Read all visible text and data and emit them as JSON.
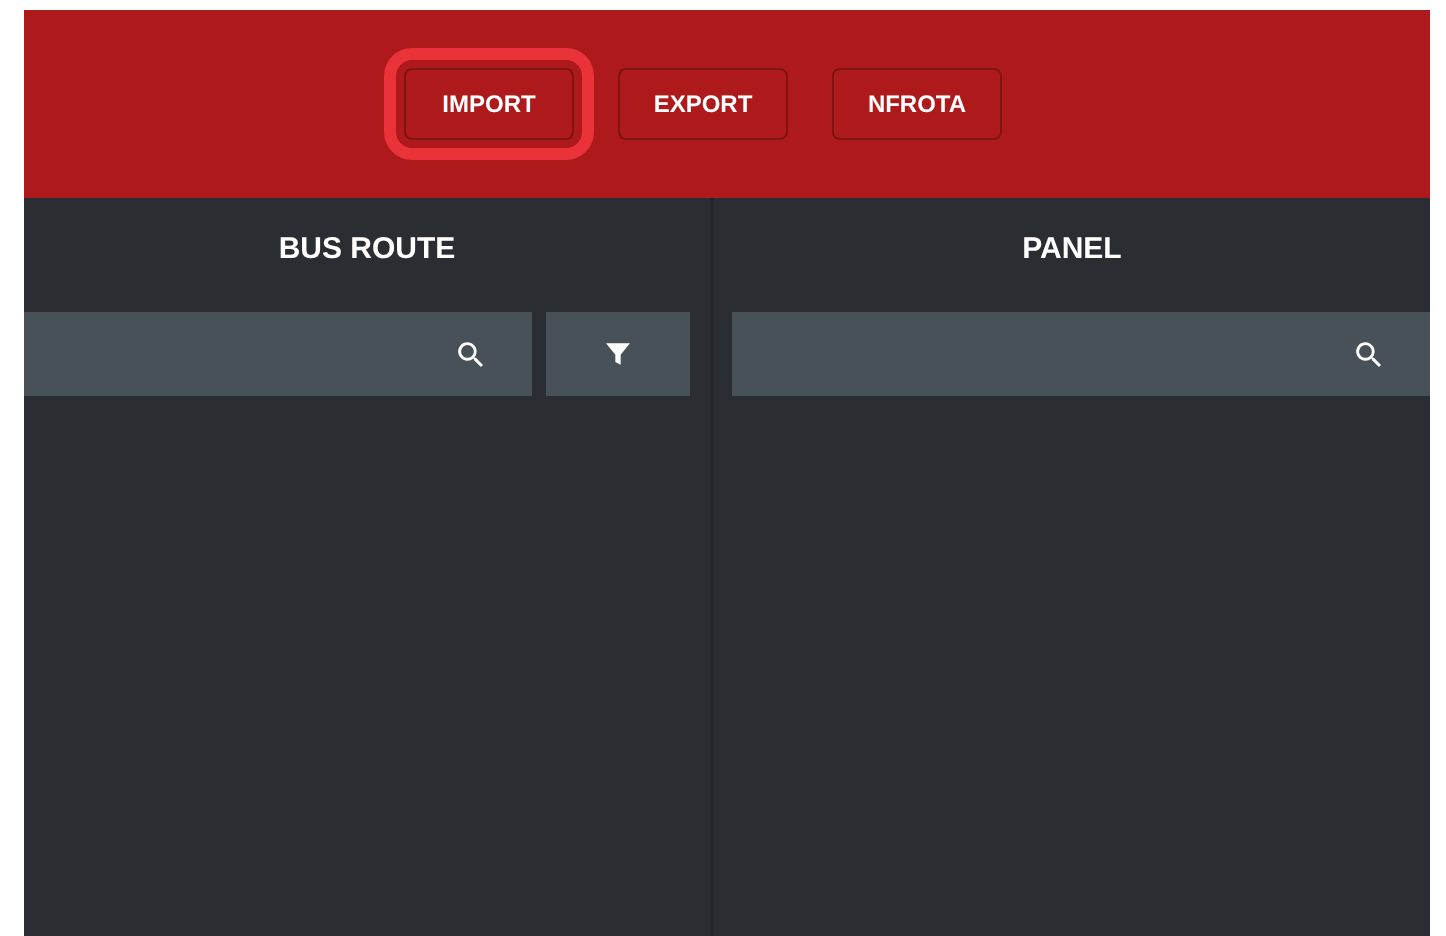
{
  "toolbar": {
    "buttons": [
      {
        "label": "IMPORT",
        "highlighted": true
      },
      {
        "label": "EXPORT",
        "highlighted": false
      },
      {
        "label": "NFROTA",
        "highlighted": false
      }
    ]
  },
  "panels": [
    {
      "title": "BUS ROUTE",
      "search": {
        "has_filter": true
      }
    },
    {
      "title": "PANEL",
      "search": {
        "has_filter": false
      }
    }
  ]
}
